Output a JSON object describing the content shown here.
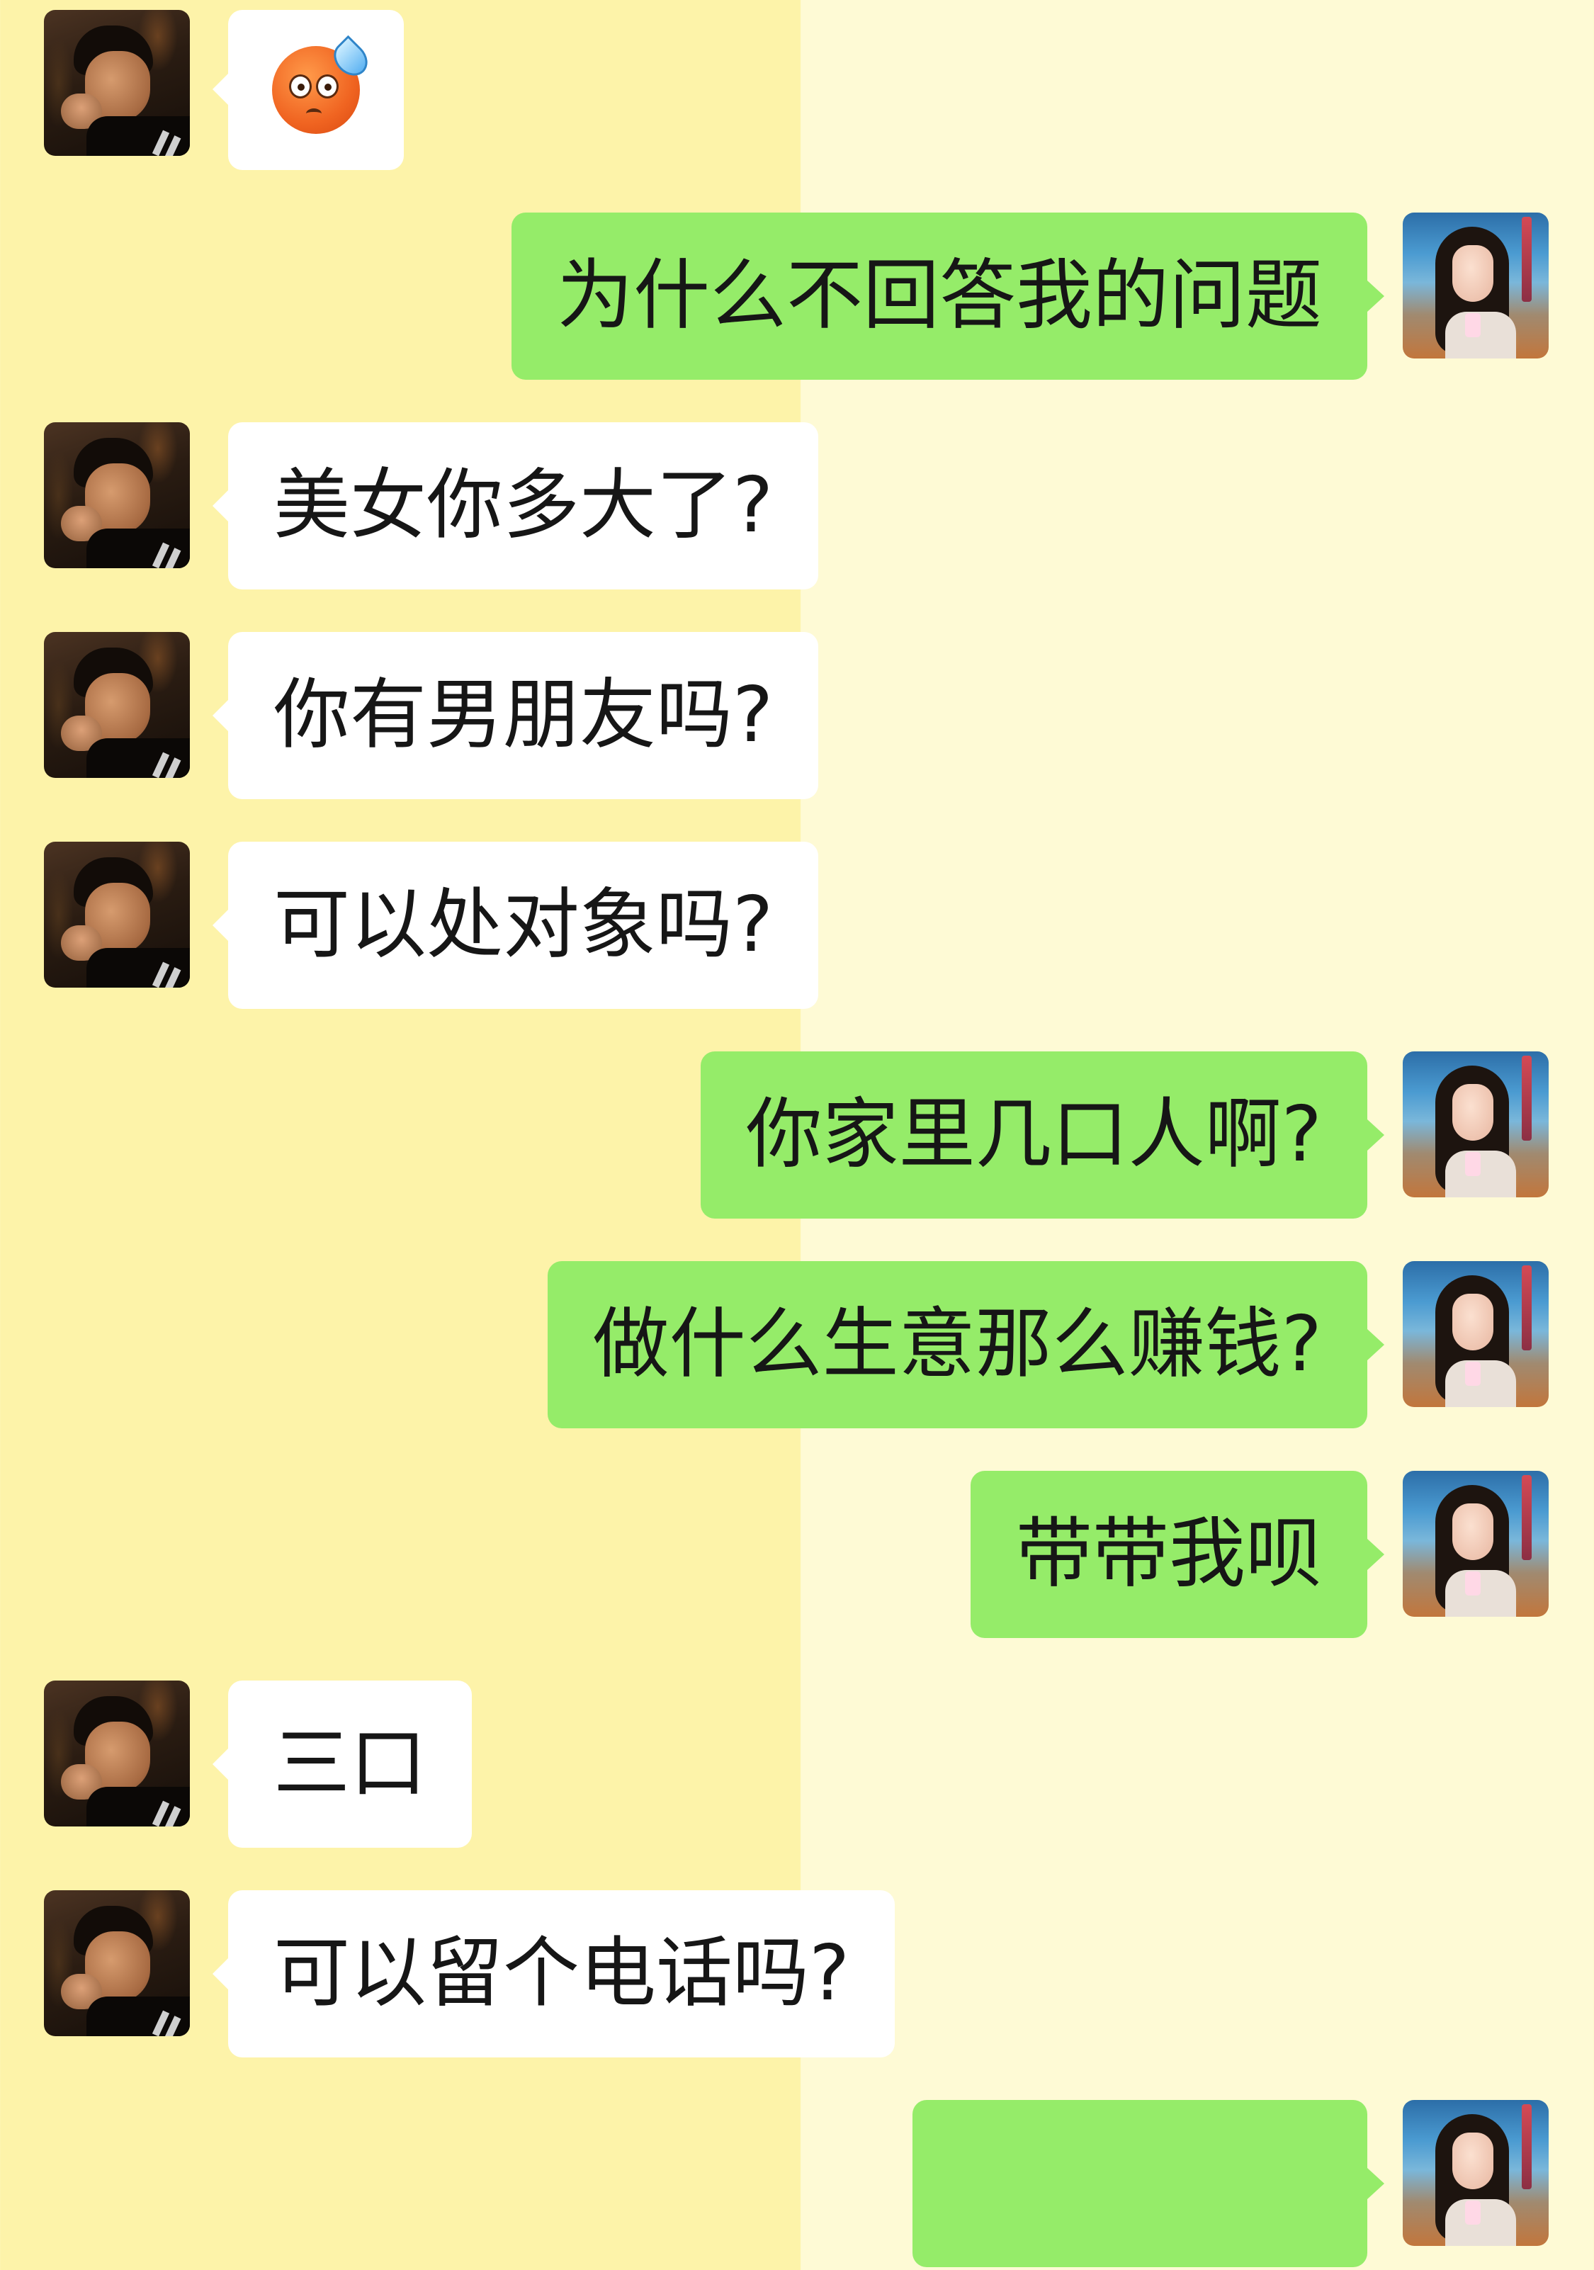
{
  "conversation": {
    "messages": [
      {
        "sender": "contact",
        "type": "emoji",
        "icon": "anxious-sweat-emoji"
      },
      {
        "sender": "self",
        "type": "text",
        "text": "为什么不回答我的问题"
      },
      {
        "sender": "contact",
        "type": "text",
        "text": "美女你多大了?"
      },
      {
        "sender": "contact",
        "type": "text",
        "text": "你有男朋友吗?"
      },
      {
        "sender": "contact",
        "type": "text",
        "text": "可以处对象吗?"
      },
      {
        "sender": "self",
        "type": "text",
        "text": "你家里几口人啊?"
      },
      {
        "sender": "self",
        "type": "text",
        "text": "做什么生意那么赚钱?"
      },
      {
        "sender": "self",
        "type": "text",
        "text": "带带我呗"
      },
      {
        "sender": "contact",
        "type": "text",
        "text": "三口"
      },
      {
        "sender": "contact",
        "type": "text",
        "text": "可以留个电话吗?"
      },
      {
        "sender": "self",
        "type": "text",
        "text": ""
      }
    ]
  },
  "colors": {
    "self_bubble": "#95ec69",
    "contact_bubble": "#ffffff",
    "background_left": "#fdf3a9",
    "background_right": "#fefad5"
  }
}
